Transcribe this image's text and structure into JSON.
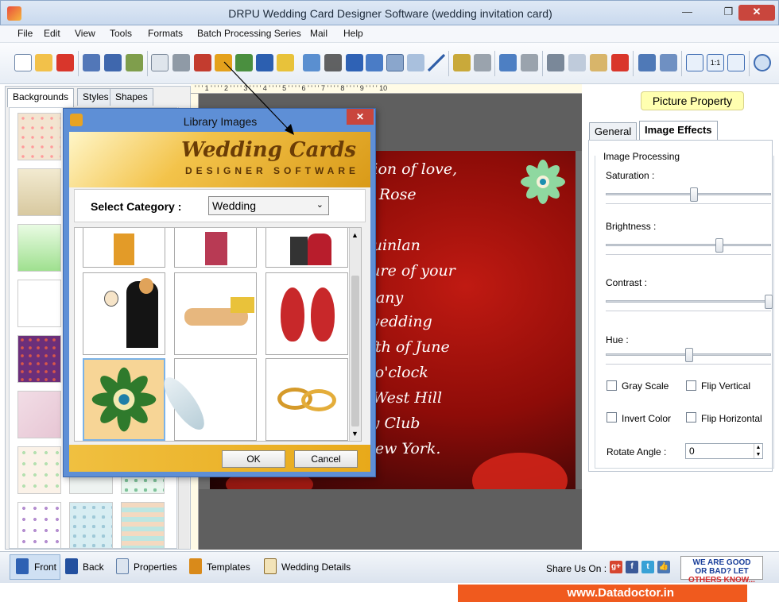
{
  "window": {
    "title": "DRPU Wedding Card Designer Software (wedding invitation card)",
    "min": "—",
    "max": "❐",
    "close": "✕"
  },
  "menu": [
    "File",
    "Edit",
    "View",
    "Tools",
    "Formats",
    "Batch Processing Series",
    "Mail",
    "Help"
  ],
  "left_panel": {
    "tabs": [
      "Backgrounds",
      "Styles",
      "Shapes"
    ]
  },
  "card": {
    "lines": [
      "the celebration of love,",
      "Amelia Rose",
      "&",
      "Liam Quinlan",
      "st the pleasure of your",
      "company",
      "at their wedding",
      "rday, the fifth of June",
      "at three o'clock",
      "Gilfillan's West Hill",
      "Country Club",
      "amillus, New York."
    ]
  },
  "right_panel": {
    "header": "Picture Property",
    "tabs": [
      "General",
      "Image Effects"
    ],
    "group_title": "Image Processing",
    "saturation": "Saturation :",
    "brightness": "Brightness :",
    "contrast": "Contrast :",
    "hue": "Hue :",
    "checkboxes": [
      "Gray Scale",
      "Flip Vertical",
      "Invert Color",
      "Flip Horizontal"
    ],
    "rotate_label": "Rotate Angle :",
    "rotate_value": "0",
    "levels": {
      "saturation": 0.53,
      "brightness": 0.69,
      "contrast": 1.0,
      "hue": 0.5
    }
  },
  "dialog": {
    "title": "Library Images",
    "close": "✕",
    "banner_title": "Wedding Cards",
    "banner_subtitle": "DESIGNER SOFTWARE",
    "category_label": "Select Category :",
    "category_value": "Wedding",
    "ok": "OK",
    "cancel": "Cancel"
  },
  "bottom": {
    "front": "Front",
    "back": "Back",
    "properties": "Properties",
    "templates": "Templates",
    "wedding_details": "Wedding Details",
    "share": "Share Us On :",
    "feedback_1": "WE ARE GOOD",
    "feedback_2": "OR BAD? LET",
    "feedback_3": "OTHERS KNOW...",
    "website": "www.Datadoctor.in"
  },
  "colors": {
    "accent": "#5e8fd6",
    "card_red": "#c01a12",
    "banner_gold": "#f3c34a",
    "brand_orange": "#f05a1e"
  }
}
